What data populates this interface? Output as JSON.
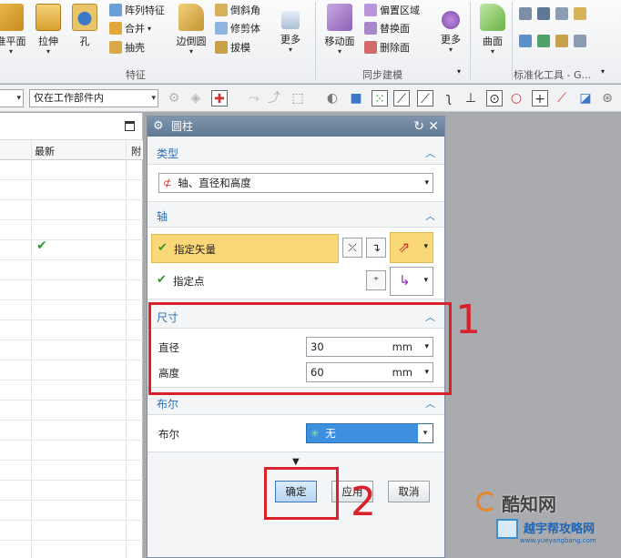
{
  "ribbon": {
    "buttons_big": [
      {
        "label": "准平面",
        "name": "datum-plane-button"
      },
      {
        "label": "拉伸",
        "name": "extrude-button"
      },
      {
        "label": "孔",
        "name": "hole-button"
      },
      {
        "label": "边倒圆",
        "name": "edge-blend-button"
      },
      {
        "label": "更多",
        "name": "more-feature-button"
      },
      {
        "label": "移动面",
        "name": "move-face-button"
      },
      {
        "label": "更多",
        "name": "more-sync-button"
      },
      {
        "label": "曲面",
        "name": "surface-button"
      }
    ],
    "buttons_small": [
      {
        "label": "阵列特征",
        "name": "pattern-feature-button"
      },
      {
        "label": "合并",
        "name": "unite-button"
      },
      {
        "label": "抽壳",
        "name": "shell-button"
      },
      {
        "label": "倒斜角",
        "name": "chamfer-button"
      },
      {
        "label": "修剪体",
        "name": "trim-body-button"
      },
      {
        "label": "拔模",
        "name": "draft-button"
      },
      {
        "label": "偏置区域",
        "name": "offset-region-button"
      },
      {
        "label": "替换面",
        "name": "replace-face-button"
      },
      {
        "label": "删除面",
        "name": "delete-face-button"
      }
    ],
    "groups": {
      "feature": "特征",
      "sync": "同步建模",
      "std_tools": "标准化工具 - G..."
    }
  },
  "toolbar": {
    "scope_value": "仅在工作部件内"
  },
  "left_panel": {
    "col_latest": "最新",
    "col_more": "附"
  },
  "dialog": {
    "title": "圆柱",
    "type": {
      "heading": "类型",
      "value": "轴、直径和高度"
    },
    "axis": {
      "heading": "轴",
      "vector_label": "指定矢量",
      "point_label": "指定点"
    },
    "dimensions": {
      "heading": "尺寸",
      "diameter_label": "直径",
      "diameter_value": "30",
      "diameter_unit": "mm",
      "height_label": "高度",
      "height_value": "60",
      "height_unit": "mm"
    },
    "boolean": {
      "heading": "布尔",
      "label": "布尔",
      "value": "无"
    },
    "buttons": {
      "ok": "确定",
      "apply": "应用",
      "cancel": "取消"
    }
  },
  "annotations": {
    "step1": "1",
    "step2": "2"
  },
  "watermark": {
    "brand": "酷知网",
    "brand2": "越宇帮攻略网",
    "url": "www.yueyangbang.com"
  },
  "colors": {
    "accent_blue": "#2c6fb0",
    "highlight_yellow": "#fbd877",
    "annotation_red": "#d8212a",
    "check_green": "#2e9a2e"
  }
}
